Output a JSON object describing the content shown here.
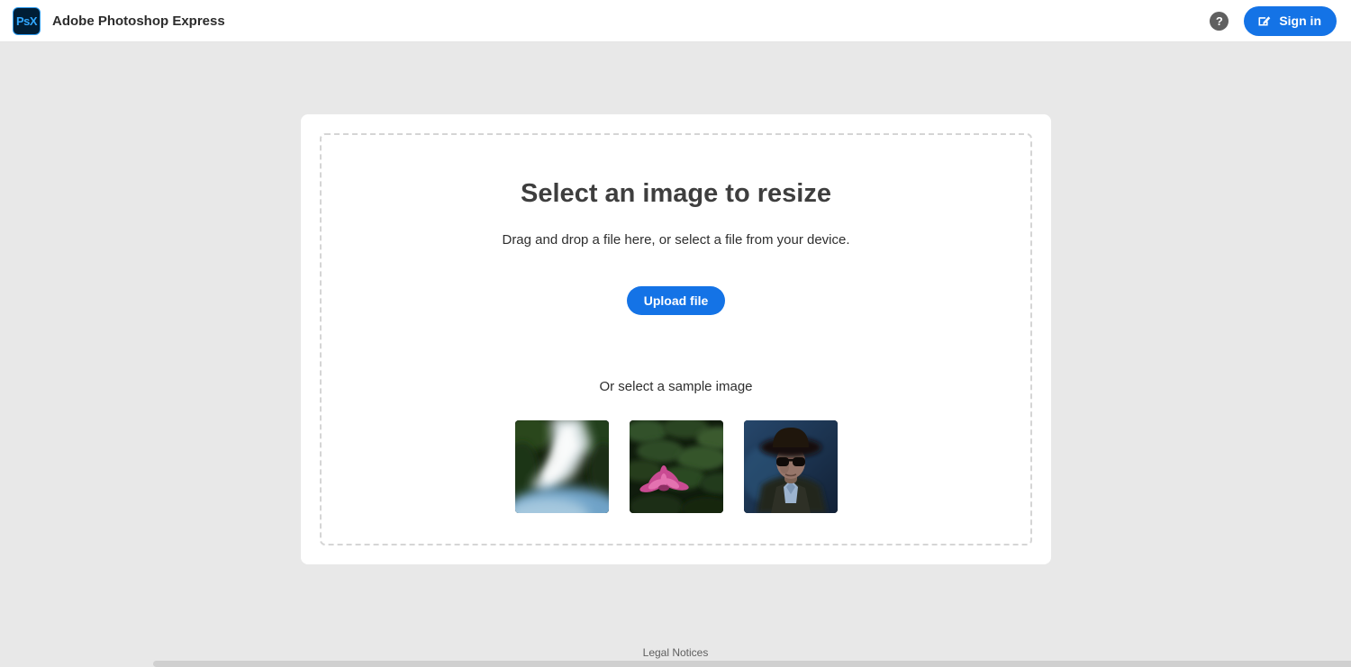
{
  "header": {
    "logo_text": "PsX",
    "app_title": "Adobe Photoshop Express",
    "help_glyph": "?",
    "sign_in_label": "Sign in"
  },
  "uploader": {
    "heading": "Select an image to resize",
    "subheading": "Drag and drop a file here, or select a file from your device.",
    "upload_button_label": "Upload file",
    "sample_prompt": "Or select a sample image",
    "samples": [
      {
        "label": "Waterfall sample image"
      },
      {
        "label": "Pink water lily sample image"
      },
      {
        "label": "Man with hat and sunglasses sample image"
      }
    ]
  },
  "footer": {
    "legal_link_label": "Legal Notices"
  },
  "colors": {
    "accent_blue": "#1473E6",
    "page_background": "#E8E8E8",
    "header_background": "#FFFFFF",
    "dashed_border": "#D5D5D5"
  }
}
